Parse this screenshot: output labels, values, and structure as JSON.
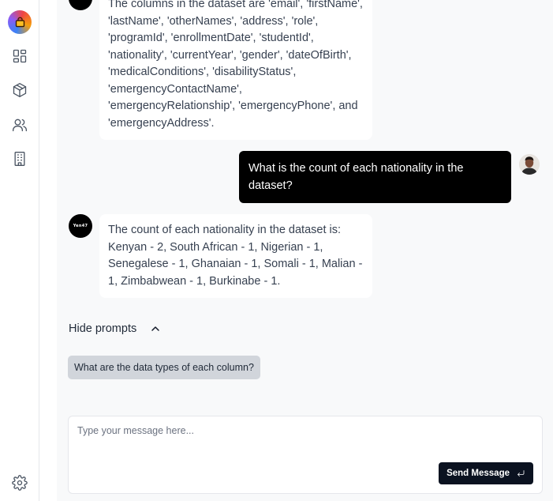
{
  "sidebar": {
    "items": [
      {
        "name": "dashboard-icon"
      },
      {
        "name": "box-icon"
      },
      {
        "name": "users-icon"
      },
      {
        "name": "building-icon"
      }
    ],
    "settings_icon": "gear-icon"
  },
  "chat": {
    "messages": [
      {
        "role": "assistant",
        "avatar_text": "Yen47",
        "text": "The columns in the dataset are 'email', 'firstName', 'lastName', 'otherNames', 'address', 'role', 'programId', 'enrollmentDate', 'studentId', 'nationality', 'currentYear', 'gender', 'dateOfBirth', 'medicalConditions', 'disabilityStatus', 'emergencyContactName', 'emergencyRelationship', 'emergencyPhone', and 'emergencyAddress'."
      },
      {
        "role": "user",
        "text": "What is the count of each nationality in the dataset?"
      },
      {
        "role": "assistant",
        "avatar_text": "Yen47",
        "text": "The count of each nationality in the dataset is: Kenyan - 2, South African - 1, Nigerian - 1, Senegalese - 1, Ghanaian - 1, Somali - 1, Malian - 1, Zimbabwean - 1, Burkinabe - 1."
      }
    ]
  },
  "prompts": {
    "toggle_label": "Hide prompts",
    "suggestions": [
      "What are the data types of each column?"
    ]
  },
  "composer": {
    "placeholder": "Type your message here...",
    "value": "",
    "send_label": "Send Message"
  }
}
